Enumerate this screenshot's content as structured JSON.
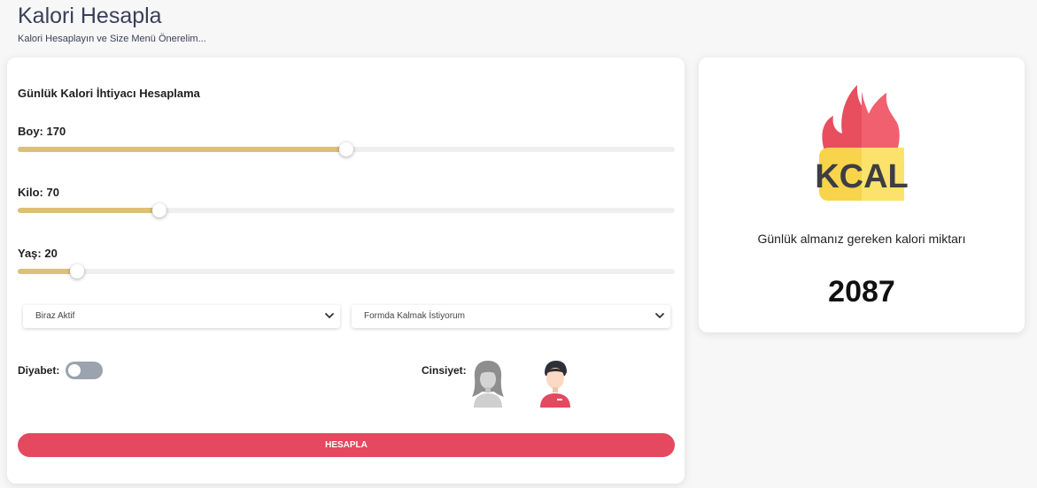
{
  "header": {
    "title": "Kalori Hesapla",
    "subtitle": "Kalori Hesaplayın ve Size Menü Önerelim..."
  },
  "form": {
    "section_title": "Günlük Kalori İhtiyacı Hesaplama",
    "sliders": [
      {
        "label": "Boy: 170",
        "fill_percent": 50
      },
      {
        "label": "Kilo: 70",
        "fill_percent": 21.5
      },
      {
        "label": "Yaş: 20",
        "fill_percent": 9
      }
    ],
    "activity_select": {
      "selected": "Biraz Aktif"
    },
    "goal_select": {
      "selected": "Formda Kalmak İstiyorum"
    },
    "diyabet_label": "Diyabet:",
    "diyabet_on": false,
    "cinsiyet_label": "Cinsiyet:",
    "submit_label": "HESAPLA"
  },
  "result": {
    "icon_text": "KCAL",
    "label": "Günlük almanız gereken kalori miktarı",
    "value": "2087"
  },
  "colors": {
    "accent": "#e4495f",
    "slider_fill": "#dcc07a",
    "toggle_off": "#9aa3ae",
    "kcal_yellow": "#fbe36b",
    "flame_red": "#e4495f"
  }
}
